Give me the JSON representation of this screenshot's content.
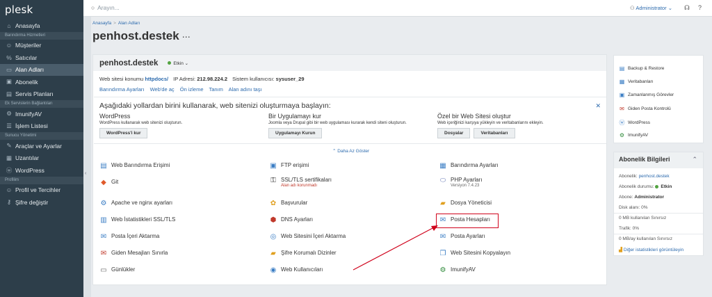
{
  "brand": "plesk",
  "sidebar": {
    "home": "Anasayfa",
    "sec_hosting": "Barındırma Hizmetleri",
    "customers": "Müşteriler",
    "resellers": "Satıcılar",
    "domains": "Alan Adları",
    "subscriptions": "Abonelik",
    "service_plans": "Servis Planları",
    "sec_extensions": "Ek Servislerin Bağlantıları",
    "imunify": "ImunifyAV",
    "task_list": "İşlem Listesi",
    "sec_server": "Sunucu Yönetimi",
    "tools": "Araçlar ve Ayarlar",
    "extensions": "Uzantılar",
    "wordpress": "WordPress",
    "sec_profile": "Profilim",
    "profile": "Profil ve Tercihler",
    "change_password": "Şifre değiştir"
  },
  "topbar": {
    "search_placeholder": "Arayın...",
    "user": "Administrator",
    "caret": "⌄"
  },
  "breadcrumb": {
    "home": "Anasayfa",
    "sep": ">",
    "domains": "Alan Adları"
  },
  "page_title": "penhost.destek",
  "domain": {
    "name": "penhost.destek",
    "status": "Etkin",
    "website_location_label": "Web sitesi konumu",
    "website_location": "httpdocs/",
    "ip_label": "IP Adresi:",
    "ip": "212.98.224.2",
    "sys_user_label": "Sistem kullanıcısı:",
    "sys_user": "sysuser_29",
    "links": [
      "Barındırma Ayarları",
      "Web'de aç",
      "Ön izleme",
      "Tanım",
      "Alan adını taşı"
    ]
  },
  "start": {
    "heading": "Aşağıdaki yollardan birini kullanarak, web sitenizi oluşturmaya başlayın:",
    "wordpress": {
      "title": "WordPress",
      "desc": "WordPress kullanarak web sitenizi oluşturun.",
      "button": "WordPress'i kur"
    },
    "app": {
      "title": "Bir Uygulamayı kur",
      "desc": "Joomla veya Drupal gibi bir web uygulaması kurarak kendi siteni oluşturun.",
      "button": "Uygulamayı Kurun"
    },
    "custom": {
      "title": "Özel bir Web Sitesi oluştur",
      "desc": "Web içeriğinizi karşıya yükleyin ve veritabanlarını ekleyin.",
      "button1": "Dosyalar",
      "button2": "Veritabanları"
    },
    "less": "Daha Az Göster"
  },
  "tools": {
    "col1": [
      "Web Barındırma Erişimi",
      "Git",
      "Apache ve nginx ayarları",
      "Web İstatistikleri SSL/TLS",
      "Posta İçeri Aktarma",
      "Giden Mesajları Sınırla",
      "Günlükler"
    ],
    "col2": [
      "FTP erişimi",
      "SSL/TLS sertifikaları",
      "Başvurular",
      "DNS Ayarları",
      "Web Sitesini İçeri Aktarma",
      "Şifre Korumalı Dizinler",
      "Web Kullanıcıları"
    ],
    "col2_ssl_sub": "Alan adı korunmadı",
    "col3": [
      "Barındırma Ayarları",
      "PHP Ayarları",
      "Dosya Yöneticisi",
      "Posta Hesapları",
      "Posta Ayarları",
      "Web Sitesini Kopyalayın",
      "ImunifyAV"
    ],
    "col3_php_sub": "Versiyon 7.4.23"
  },
  "right_links": [
    "Backup & Restore",
    "Veritabanları",
    "Zamanlanmış Görevler",
    "Giden Posta Kontrolü",
    "WordPress",
    "ImunifyAV"
  ],
  "subscription": {
    "title": "Abonelik Bilgileri",
    "sub_label": "Abonelik:",
    "sub_value": "penhost.destek",
    "status_label": "Abonelik durumu:",
    "status_value": "Etkin",
    "owner_label": "Abone:",
    "owner_value": "Administrator",
    "disk": "Disk alanı: 0%",
    "disk_used": "0 MB kullanılan Sınırsız",
    "traffic": "Trafik: 0%",
    "traffic_used": "0 MB/ay kullanılan Sınırsız",
    "more": "Diğer istatistikleri görüntüleyin"
  },
  "colors": {
    "sidebar": "#2d3e4a",
    "link": "#2c6aad",
    "status_green": "#52a340",
    "highlight": "#d0021b",
    "annotation_arrow": "#d0021b"
  }
}
